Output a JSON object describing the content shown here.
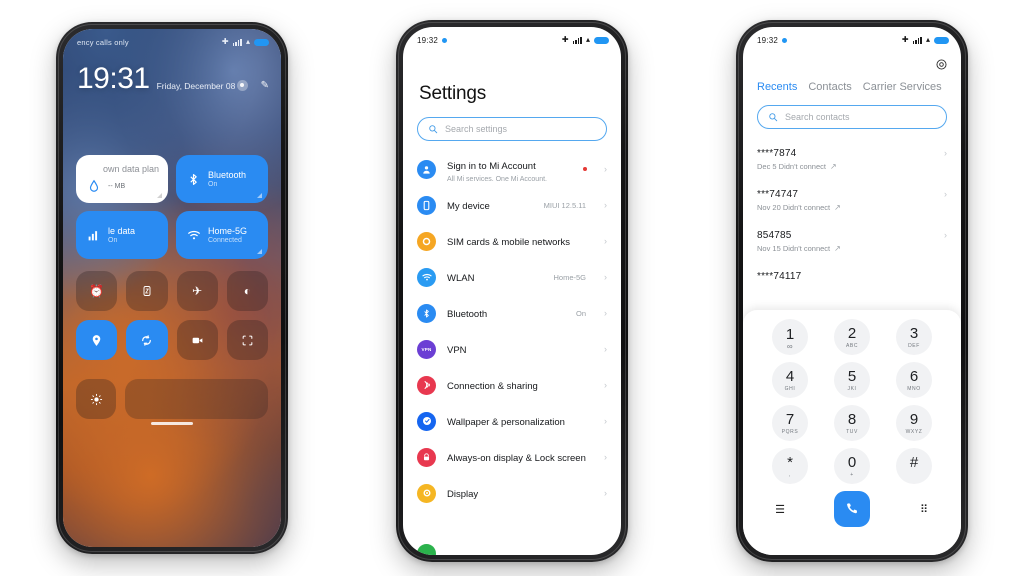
{
  "phone1": {
    "name": "lockscreen-control-center",
    "status": {
      "carrier": "ency calls only",
      "icons": [
        "bluetooth-icon",
        "signal-icon",
        "wifi-icon",
        "battery-icon"
      ]
    },
    "clock": {
      "time": "19:31",
      "date": "Friday, December 08",
      "icons": [
        "settings-dot-icon",
        "edit-pencil-icon"
      ]
    },
    "tiles": [
      {
        "title": "own data plan",
        "sub": "-- MB",
        "style": "white",
        "icon": "water-drop-icon"
      },
      {
        "title": "Bluetooth",
        "sub": "On",
        "style": "blue",
        "icon": "bluetooth-icon"
      },
      {
        "title": "le data",
        "sub": "On",
        "style": "blue",
        "icon": "signal-bars-icon"
      },
      {
        "title": "Home-5G",
        "sub": "Connected",
        "style": "blue",
        "icon": "wifi-icon"
      }
    ],
    "small_tiles": [
      {
        "icon": "alarm-icon",
        "on": false
      },
      {
        "icon": "do-not-disturb-icon",
        "on": false
      },
      {
        "icon": "airplane-mode-icon",
        "on": false
      },
      {
        "icon": "dark-mode-icon",
        "on": false
      },
      {
        "icon": "location-icon",
        "on": true
      },
      {
        "icon": "sync-icon",
        "on": true
      },
      {
        "icon": "screen-recorder-icon",
        "on": false
      },
      {
        "icon": "scanner-icon",
        "on": false
      }
    ],
    "brightness": {
      "icon": "brightness-icon"
    }
  },
  "phone2": {
    "name": "settings-app",
    "status": {
      "time": "19:32"
    },
    "title": "Settings",
    "search": {
      "placeholder": "Search settings",
      "icon": "search-icon"
    },
    "items": [
      {
        "label": "Sign in to Mi Account",
        "sub": "All Mi services. One Mi Account.",
        "value": "",
        "dot": true,
        "icon": "account-icon",
        "color": "#2a8bf2"
      },
      {
        "label": "My device",
        "sub": "",
        "value": "MIUI 12.5.11",
        "dot": false,
        "icon": "device-icon",
        "color": "#2a8bf2"
      },
      {
        "label": "SIM cards & mobile networks",
        "sub": "",
        "value": "",
        "dot": false,
        "icon": "sim-card-icon",
        "color": "#f5a623"
      },
      {
        "label": "WLAN",
        "sub": "",
        "value": "Home-5G",
        "dot": false,
        "icon": "wifi-icon",
        "color": "#2a9bf2"
      },
      {
        "label": "Bluetooth",
        "sub": "",
        "value": "On",
        "dot": false,
        "icon": "bluetooth-icon",
        "color": "#2a8bf2"
      },
      {
        "label": "VPN",
        "sub": "",
        "value": "",
        "dot": false,
        "icon": "vpn-icon",
        "color": "#6b3fd4"
      },
      {
        "label": "Connection & sharing",
        "sub": "",
        "value": "",
        "dot": false,
        "icon": "connection-sharing-icon",
        "color": "#e8384f"
      },
      {
        "label": "Wallpaper & personalization",
        "sub": "",
        "value": "",
        "dot": false,
        "icon": "wallpaper-icon",
        "color": "#1565f0"
      },
      {
        "label": "Always-on display & Lock screen",
        "sub": "",
        "value": "",
        "dot": false,
        "icon": "lock-icon",
        "color": "#e8384f"
      },
      {
        "label": "Display",
        "sub": "",
        "value": "",
        "dot": false,
        "icon": "display-icon",
        "color": "#f5b623"
      }
    ]
  },
  "phone3": {
    "name": "phone-dialer-app",
    "status": {
      "time": "19:32"
    },
    "settings_icon": "gear-icon",
    "tabs": [
      {
        "label": "Recents",
        "active": true
      },
      {
        "label": "Contacts",
        "active": false
      },
      {
        "label": "Carrier Services",
        "active": false
      }
    ],
    "search": {
      "placeholder": "Search contacts",
      "icon": "search-icon"
    },
    "calls": [
      {
        "number": "****7874",
        "detail": "Dec 5 Didn't connect",
        "arrow": "outgoing-call-icon"
      },
      {
        "number": "***74747",
        "detail": "Nov 20 Didn't connect",
        "arrow": "outgoing-call-icon"
      },
      {
        "number": "854785",
        "detail": "Nov 15 Didn't connect",
        "arrow": "outgoing-call-icon"
      },
      {
        "number": "****74117",
        "detail": "",
        "arrow": ""
      }
    ],
    "keypad": [
      {
        "digit": "1",
        "letters": "∞"
      },
      {
        "digit": "2",
        "letters": "ABC"
      },
      {
        "digit": "3",
        "letters": "DEF"
      },
      {
        "digit": "4",
        "letters": "GHI"
      },
      {
        "digit": "5",
        "letters": "JKI"
      },
      {
        "digit": "6",
        "letters": "MNO"
      },
      {
        "digit": "7",
        "letters": "PQRS"
      },
      {
        "digit": "8",
        "letters": "TUV"
      },
      {
        "digit": "9",
        "letters": "WXYZ"
      },
      {
        "digit": "*",
        "letters": ","
      },
      {
        "digit": "0",
        "letters": "+"
      },
      {
        "digit": "#",
        "letters": ""
      }
    ],
    "footer": {
      "left_icon": "menu-icon",
      "call_icon": "call-handset-icon",
      "right_icon": "keypad-icon"
    }
  },
  "colors": {
    "accent": "#2a8bf2",
    "tile_blue": "#2a8bf2",
    "badge_red": "#e53935",
    "key_bg": "#f1f2f4"
  }
}
